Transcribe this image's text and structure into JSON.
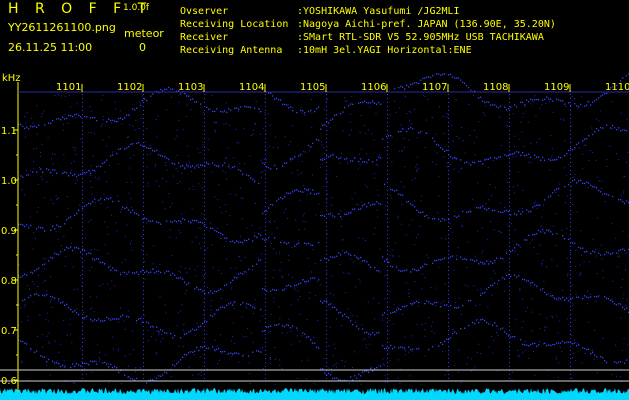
{
  "app": {
    "title": "H R O F F T",
    "version": "1.0.0f",
    "filename": "YY2611261100.png",
    "datetime": "26.11.25 11:00",
    "meteor_label": "meteor",
    "meteor_count": "0"
  },
  "info": [
    {
      "label": "Ovserver",
      "value": ":YOSHIKAWA Yasufumi /JG2MLI"
    },
    {
      "label": "Receiving Location",
      "value": ":Nagoya Aichi-pref. JAPAN (136.90E, 35.20N)"
    },
    {
      "label": "Receiver",
      "value": ":SMart RTL-SDR V5 52.905MHz USB TACHIKAWA"
    },
    {
      "label": "Receiving Antenna",
      "value": ":10mH 3el.YAGI Horizontal:ENE"
    }
  ],
  "spectrogram": {
    "unit": "kHz",
    "time_labels": [
      "1101",
      "1102",
      "1103",
      "1104",
      "1105",
      "1106",
      "1107",
      "1108",
      "1109",
      "1110"
    ],
    "freq_labels": [
      "1.1",
      "1.0",
      "0.9",
      "0.8",
      "0.7",
      "0.6"
    ],
    "colors": {
      "signal": "#3344ff",
      "axis": "#ffff00",
      "noise_floor": "#00d8ff",
      "grid": "#2a2aa0"
    }
  }
}
